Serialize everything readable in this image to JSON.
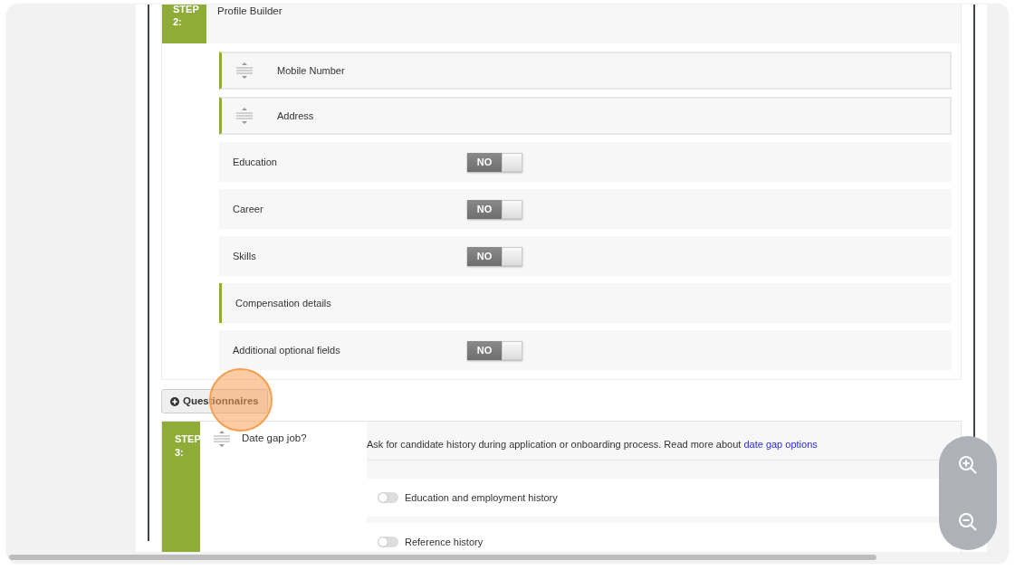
{
  "step2": {
    "badge_lines": [
      "STEP",
      "2:"
    ],
    "title": "Profile Builder",
    "fields": [
      {
        "kind": "draggable",
        "label": "Mobile Number"
      },
      {
        "kind": "draggable",
        "label": "Address"
      },
      {
        "kind": "toggle",
        "label": "Education",
        "on": false,
        "toggle_text": "NO"
      },
      {
        "kind": "toggle",
        "label": "Career",
        "on": false,
        "toggle_text": "NO"
      },
      {
        "kind": "toggle",
        "label": "Skills",
        "on": false,
        "toggle_text": "NO"
      },
      {
        "kind": "section",
        "label": "Compensation details"
      },
      {
        "kind": "toggle",
        "label": "Additional optional fields",
        "on": false,
        "toggle_text": "NO"
      }
    ]
  },
  "questionnaires_button": {
    "label": "Questionnaires"
  },
  "step3": {
    "badge_lines": [
      "STEP",
      "3:"
    ],
    "question": "Date gap job?",
    "description": "Ask for candidate history during application or onboarding process. Read more about",
    "link": "date gap options",
    "options": [
      {
        "label": "Education and employment history",
        "on": false
      },
      {
        "label": "Reference history",
        "on": false
      }
    ]
  }
}
